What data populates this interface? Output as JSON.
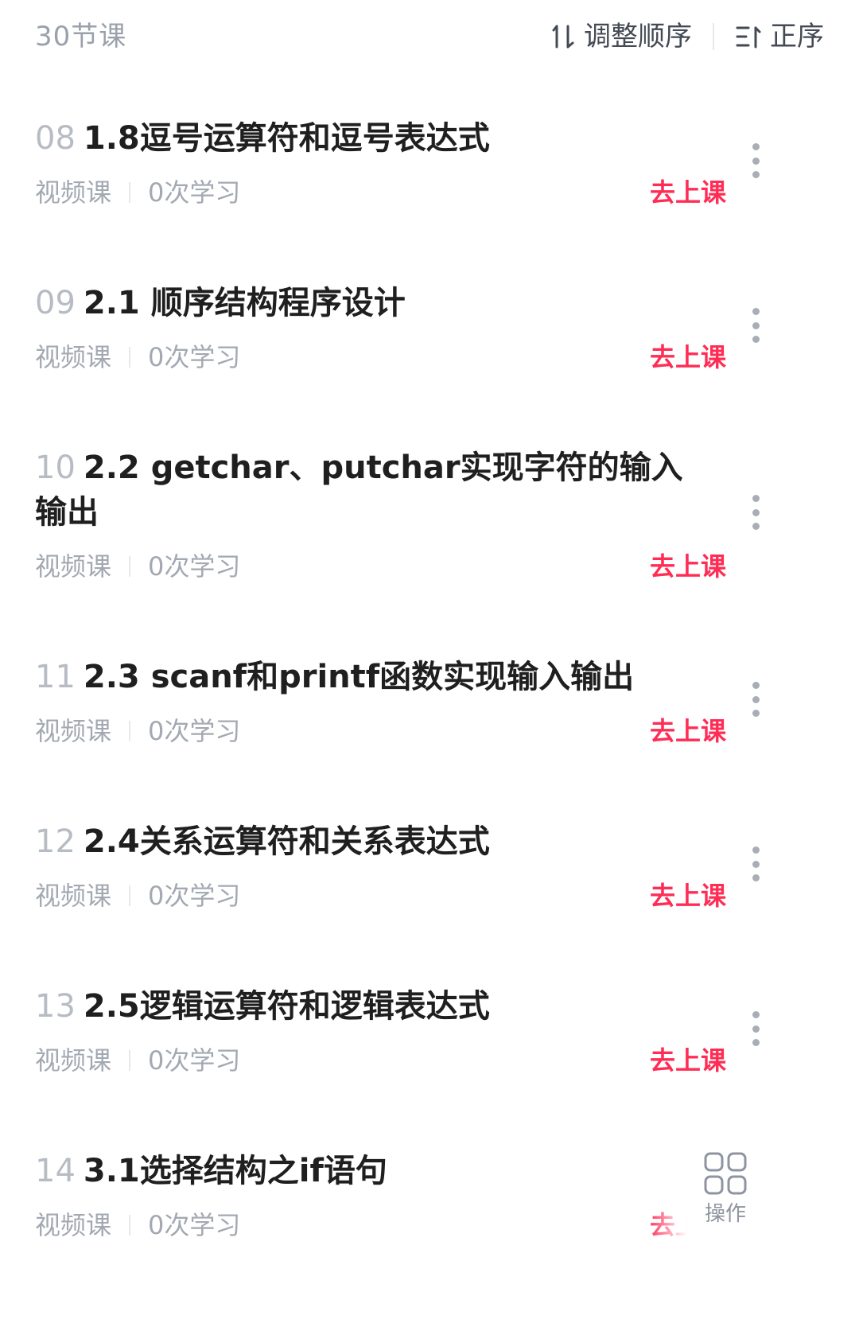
{
  "header": {
    "lesson_count": "30节课",
    "adjust_order_label": "调整顺序",
    "sort_label": "正序"
  },
  "lessons": [
    {
      "index": "08",
      "title": "1.8逗号运算符和逗号表达式",
      "type": "视频课",
      "study_count": "0次学习",
      "action": "去上课"
    },
    {
      "index": "09",
      "title": "2.1 顺序结构程序设计",
      "type": "视频课",
      "study_count": "0次学习",
      "action": "去上课"
    },
    {
      "index": "10",
      "title": "2.2 getchar、putchar实现字符的输入输出",
      "type": "视频课",
      "study_count": "0次学习",
      "action": "去上课"
    },
    {
      "index": "11",
      "title": "2.3 scanf和printf函数实现输入输出",
      "type": "视频课",
      "study_count": "0次学习",
      "action": "去上课"
    },
    {
      "index": "12",
      "title": "2.4关系运算符和关系表达式",
      "type": "视频课",
      "study_count": "0次学习",
      "action": "去上课"
    },
    {
      "index": "13",
      "title": "2.5逻辑运算符和逻辑表达式",
      "type": "视频课",
      "study_count": "0次学习",
      "action": "去上课"
    },
    {
      "index": "14",
      "title": "3.1选择结构之if语句",
      "type": "视频课",
      "study_count": "0次学习",
      "action": "去上课"
    }
  ],
  "fab": {
    "label": "操作",
    "icon": "grid-icon"
  },
  "colors": {
    "accent": "#ff2d55",
    "muted": "#a3a9b2",
    "title": "#1f1f1f"
  }
}
